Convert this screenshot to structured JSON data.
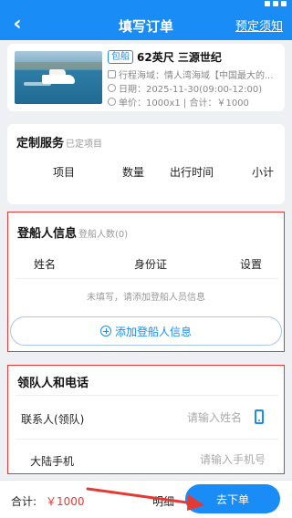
{
  "header": {
    "title": "填写订单",
    "right_link": "预定须知",
    "back_icon": "‹"
  },
  "product": {
    "tag": "包船",
    "name": "62英尺 三源世纪",
    "route": "行程海域：情人湾海域【中国最大的...",
    "date": "日期：2025-11-30(09:00-12:00)",
    "price": "单价：1000x1 | 合计：￥1000"
  },
  "services": {
    "title": "定制服务",
    "subtitle": "已定项目",
    "columns": [
      "项目",
      "数量",
      "出行时间",
      "小计"
    ]
  },
  "passengers": {
    "title": "登船人信息",
    "subtitle": "登船人数(0)",
    "columns": [
      "姓名",
      "身份证",
      "设置"
    ],
    "empty": "未填写，请添加登船人员信息",
    "add_label": "添加登船人信息"
  },
  "leader": {
    "title": "领队人和电话",
    "contact_label": "联系人(领队)",
    "contact_placeholder": "请输入姓名",
    "phone_label": "大陆手机",
    "phone_placeholder": "请输入手机号"
  },
  "footer": {
    "total_label": "合计:",
    "total_value": "￥1000",
    "detail_label": "明细",
    "submit_label": "去下单"
  },
  "colors": {
    "primary": "#1a8cf5",
    "highlight_border": "#e53935",
    "price": "#e53935"
  }
}
